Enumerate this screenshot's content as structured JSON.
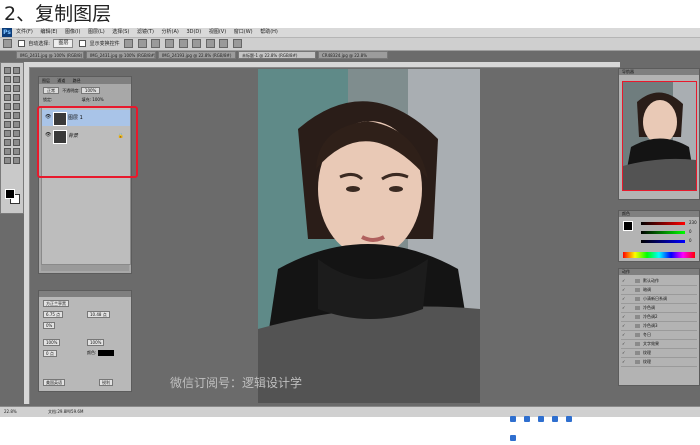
{
  "heading": "2、复制图层",
  "app": {
    "logo": "Ps",
    "menus": [
      "文件(F)",
      "编辑(E)",
      "图像(I)",
      "图层(L)",
      "选择(S)",
      "滤镜(T)",
      "分析(A)",
      "3D(D)",
      "视图(V)",
      "窗口(W)",
      "帮助(H)"
    ]
  },
  "options": {
    "auto_select_label": "自动选择:",
    "auto_select_value": "图层",
    "transform_label": "显示变换控件"
  },
  "tabs": [
    "IMG_2431.jpg @ 100% (RGB/8)",
    "IMG_2431.jpg @ 100% (RGB/8#)",
    "IMG_24193.jpg @ 22.8% (RGB/8#)",
    "未标题-1 @ 22.8% (RGB/8#)",
    "CR48324.jpg @ 22.8%"
  ],
  "layers_panel": {
    "tabs": [
      "图层",
      "通道",
      "路径"
    ],
    "blend_mode": "正常",
    "opacity_label": "不透明度:",
    "opacity_value": "100%",
    "lock_label": "锁定:",
    "fill_label": "填充:",
    "fill_value": "100%",
    "layers": [
      {
        "name": "图层 1",
        "selected": true
      },
      {
        "name": "背景",
        "selected": false,
        "locked": true
      }
    ]
  },
  "char_panel": {
    "font": "方正兰亭黑",
    "size": "6.75 点",
    "leading": "10.48 点",
    "tracking": "0%",
    "scale_v": "100%",
    "scale_h": "100%",
    "baseline": "0 点",
    "color_label": "颜色:",
    "aa": "锐利",
    "lang": "美国英语"
  },
  "navigator": {
    "title": "导航器"
  },
  "color_panel": {
    "title": "颜色",
    "values": [
      "230",
      "0",
      "0"
    ]
  },
  "actions_panel": {
    "title": "动作",
    "items": [
      "默认动作",
      "暗调",
      "小清新日系调",
      "冷色调",
      "冷色调2",
      "冷色调3",
      "冬日",
      "文字效果",
      "纹理",
      "纹理"
    ]
  },
  "status": {
    "zoom": "22.8%",
    "doc": "文档:29.8M/59.6M"
  },
  "watermark": "微信订阅号：逻辑设计学",
  "colors": {
    "highlight": "#e8192c",
    "selected_layer": "#a9c4e8"
  }
}
